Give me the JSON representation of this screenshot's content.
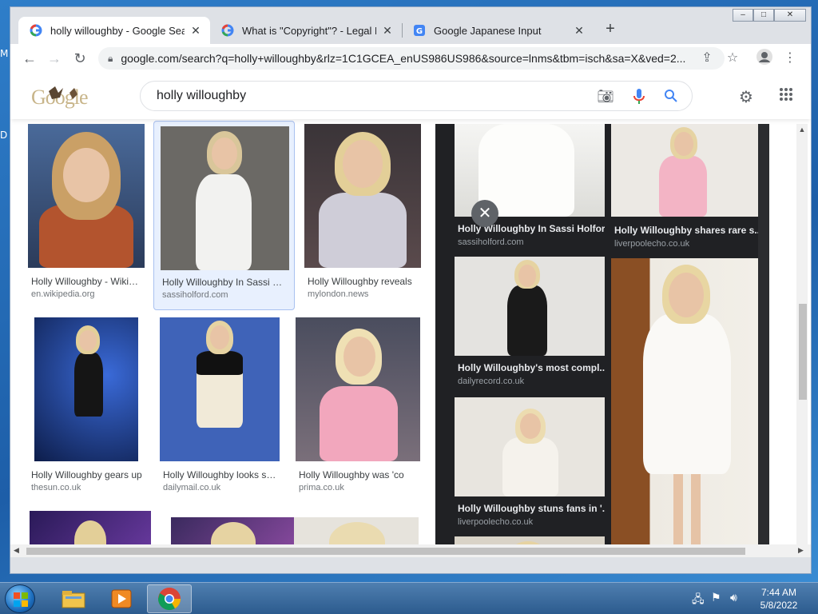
{
  "desktop": {
    "letters": [
      "M",
      "D"
    ]
  },
  "browser": {
    "tabs": [
      {
        "title": "holly willoughby - Google Search",
        "active": true,
        "icon": "google-g-icon"
      },
      {
        "title": "What is \"Copyright\"? - Legal Help",
        "active": false,
        "icon": "google-g-icon"
      },
      {
        "title": "Google Japanese Input",
        "active": false,
        "icon": "google-translate-icon"
      }
    ],
    "new_tab_label": "+",
    "window_controls": {
      "minimize": "–",
      "maximize": "□",
      "close": "✕"
    },
    "address": "google.com/search?q=holly+willoughby&rlz=1C1GCEA_enUS986US986&source=lnms&tbm=isch&sa=X&ved=2..."
  },
  "search": {
    "logo_text": "Google",
    "query": "holly willoughby"
  },
  "results": [
    {
      "title": "Holly Willoughby - Wikipedia",
      "source": "en.wikipedia.org"
    },
    {
      "title": "Holly Willoughby In Sassi Holford",
      "source": "sassiholford.com"
    },
    {
      "title": "Holly Willoughby reveals",
      "source": "mylondon.news"
    },
    {
      "title": "Holly Willoughby gears up",
      "source": "thesun.co.uk"
    },
    {
      "title": "Holly Willoughby looks stunning",
      "source": "dailymail.co.uk"
    },
    {
      "title": "Holly Willoughby was 'co",
      "source": "prima.co.uk"
    }
  ],
  "panel": {
    "close_label": "✕",
    "items": [
      {
        "title": "Holly Willoughby In Sassi Holford",
        "source": "sassiholford.com"
      },
      {
        "title": "Holly Willoughby shares rare s...",
        "source": "liverpoolecho.co.uk"
      },
      {
        "title": "Holly Willoughby's most compl...",
        "source": "dailyrecord.co.uk"
      },
      {
        "title": "Holly Willoughby stuns fans in '...",
        "source": "liverpoolecho.co.uk"
      }
    ]
  },
  "taskbar": {
    "time": "7:44 AM",
    "date": "5/8/2022"
  },
  "colors": {
    "accent_blue": "#1a73e8",
    "panel_bg": "#202124",
    "taskbar": "#2c5b8e"
  }
}
